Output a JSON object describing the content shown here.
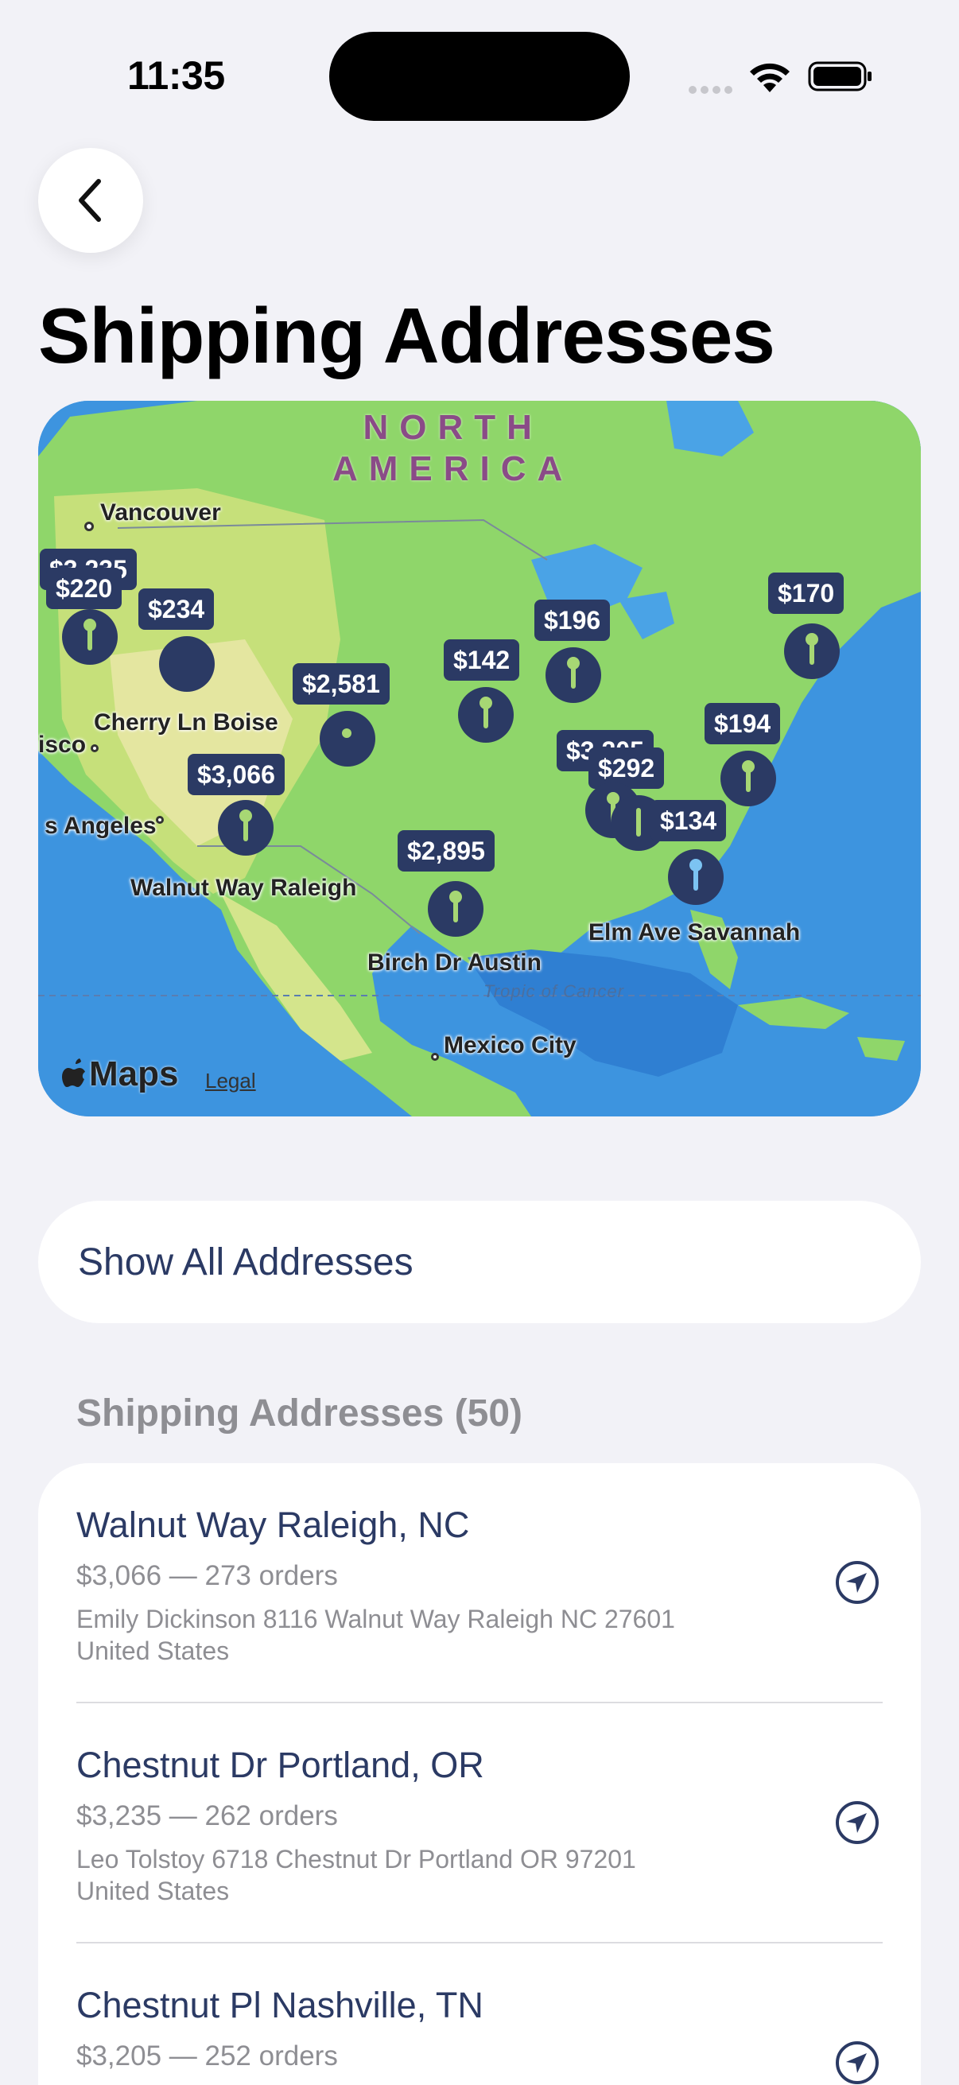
{
  "status_bar": {
    "time": "11:35"
  },
  "page": {
    "title": "Shipping Addresses"
  },
  "map": {
    "continent_label_line1": "NORTH",
    "continent_label_line2": "AMERICA",
    "city_labels": [
      "Vancouver",
      "Cherry Ln Boise",
      "isco",
      "s Angeles",
      "Walnut Way Raleigh",
      "Birch Dr Austin",
      "Mexico City",
      "Elm Ave Savannah"
    ],
    "tropic_label": "Tropic of Cancer",
    "price_tags": [
      "$3,235",
      "$220",
      "$234",
      "$2",
      "$2,581",
      "$3,066",
      "$142",
      "$196",
      "$3,205",
      "$292",
      "$134",
      "$194",
      "$170",
      "$2,895"
    ],
    "maps_label": "Maps",
    "legal_label": "Legal"
  },
  "show_all": {
    "label": "Show All Addresses"
  },
  "section": {
    "header": "Shipping Addresses (50)"
  },
  "addresses": [
    {
      "title": "Walnut Way Raleigh, NC",
      "summary": "$3,066 — 273 orders",
      "address_line1": "Emily Dickinson 8116 Walnut Way Raleigh NC 27601",
      "address_line2": "United States"
    },
    {
      "title": "Chestnut Dr Portland, OR",
      "summary": "$3,235 — 262 orders",
      "address_line1": "Leo Tolstoy 6718 Chestnut Dr Portland OR 97201",
      "address_line2": "United States"
    },
    {
      "title": "Chestnut Pl Nashville, TN",
      "summary": "$3,205 — 252 orders",
      "address_line1": "",
      "address_line2": ""
    }
  ],
  "colors": {
    "accent": "#2b3a64",
    "background": "#f2f2f7",
    "pin_green": "#a7d774",
    "pin_blue": "#7cc3f2"
  }
}
